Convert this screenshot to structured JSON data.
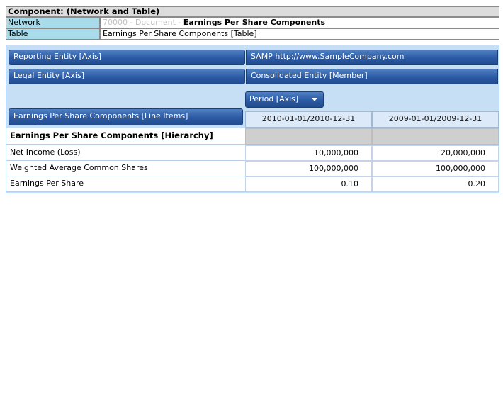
{
  "component": {
    "title": "Component: (Network and Table)",
    "network_label": "Network",
    "network_doc_id": "70000 - Document - ",
    "network_doc_name": "Earnings Per Share Components",
    "table_label": "Table",
    "table_value": "Earnings Per Share Components [Table]"
  },
  "axes": {
    "reporting_entity_label": "Reporting Entity [Axis]",
    "reporting_entity_value": "SAMP http://www.SampleCompany.com",
    "legal_entity_label": "Legal Entity [Axis]",
    "legal_entity_value": "Consolidated Entity [Member]",
    "period_label": "Period [Axis]",
    "line_items_label": "Earnings Per Share Components [Line Items]"
  },
  "columns": [
    "2010-01-01/2010-12-31",
    "2009-01-01/2009-12-31"
  ],
  "hierarchy_label": "Earnings Per Share Components [Hierarchy]",
  "rows": [
    {
      "label": "Net Income (Loss)",
      "values": [
        "10,000,000",
        "20,000,000"
      ]
    },
    {
      "label": "Weighted Average Common Shares",
      "values": [
        "100,000,000",
        "100,000,000"
      ]
    },
    {
      "label": "Earnings Per Share",
      "values": [
        "0.10",
        "0.20"
      ]
    }
  ]
}
